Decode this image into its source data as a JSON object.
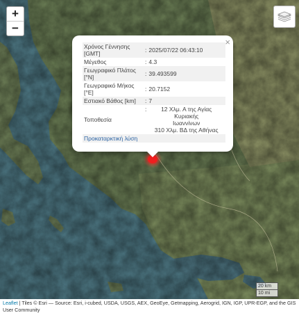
{
  "map": {
    "zoom_in_label": "+",
    "zoom_out_label": "−",
    "layers_icon": "layers-icon",
    "marker_color": "#ef1f1f"
  },
  "popup": {
    "close_label": "×",
    "rows": [
      {
        "label": "Χρόνος Γέννησης [GMT]",
        "value": "2025/07/22 06:43:10"
      },
      {
        "label": "Μέγεθος",
        "value": "4.3"
      },
      {
        "label": "Γεωγραφικό Πλάτος [°N]",
        "value": "39.493599"
      },
      {
        "label": "Γεωγραφικό Μήκος [°E]",
        "value": "20.7152"
      },
      {
        "label": "Εστιακό Βάθος [km]",
        "value": "7"
      }
    ],
    "location_label": "Τοποθεσία",
    "location_line1": "12 Χλμ. Α της Αγίας Κυριακής",
    "location_line2": "Ιωαννίνων",
    "location_line3": "310 Χλμ. ΒΔ της Αθήνας",
    "prelim_link": "Προκαταρκτική λύση",
    "separator": ":"
  },
  "scale": {
    "km": "20 km",
    "mi": "10 mi"
  },
  "attribution": {
    "leaflet": "Leaflet",
    "text": " | Tiles © Esri — Source: Esri, i-cubed, USDA, USGS, AEX, GeoEye, Getmapping, Aerogrid, IGN, IGP, UPR-EGP, and the GIS User Community"
  }
}
